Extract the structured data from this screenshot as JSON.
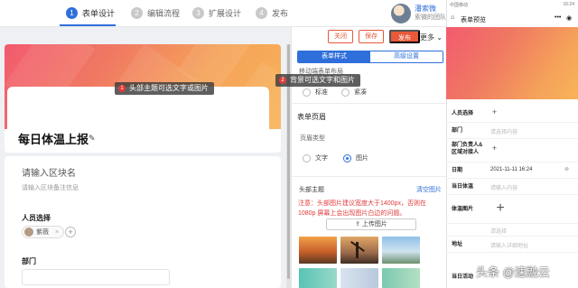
{
  "steps": [
    {
      "num": "1",
      "label": "表单设计"
    },
    {
      "num": "2",
      "label": "编辑流程"
    },
    {
      "num": "3",
      "label": "扩展设计"
    },
    {
      "num": "4",
      "label": "发布"
    }
  ],
  "user": {
    "name": "潘索微",
    "org": "索微的团队"
  },
  "toolbar": {
    "close": "关闭",
    "save": "保存",
    "publish": "发布",
    "more": "更多"
  },
  "form": {
    "title": "每日体温上报",
    "tip_header": "头部主题可选文字或图片",
    "tip_header_num": "1",
    "tip_bg": "背景可选文字和图片",
    "tip_bg_num": "2",
    "section_title_placeholder": "请输入区块名",
    "section_desc_placeholder": "请输入区块备注信息",
    "person_label": "人员选择",
    "person_chip": "紫薇",
    "chip_close": "×",
    "add": "+",
    "dept_label": "部门"
  },
  "panel": {
    "tab_form_style": "表单样式",
    "tab_advanced": "高级设置",
    "mobile_layout": "移动端表单布局",
    "layout_standard": "标准",
    "layout_compact": "紧凑",
    "header_section": "表单页眉",
    "header_type": "页眉类型",
    "type_text": "文字",
    "type_image": "图片",
    "header_theme": "头部主题",
    "clear_image": "清空图片",
    "warning": "注意：头部图片建议宽度大于1400px，否则在 1080p 屏幕上会出现图片白边的问题。",
    "upload": "上传图片"
  },
  "preview": {
    "status_left": "中国移动",
    "status_right": "16:24",
    "title": "表单预览",
    "rows": [
      {
        "label": "人员选择",
        "value": "+"
      },
      {
        "label": "部门",
        "value": "请选择内容"
      },
      {
        "label": "部门负责人&区域对接人",
        "value": "+"
      },
      {
        "label": "日期",
        "value": "2021-11-11 16:24"
      },
      {
        "label": "当日体温",
        "value": "请输入内容"
      },
      {
        "label": "体温图片",
        "value": "+"
      },
      {
        "label": "",
        "value": "请选择"
      },
      {
        "label": "地址",
        "value": "请输入详细地址"
      },
      {
        "label": "当日活动",
        "value": ""
      }
    ]
  },
  "watermark": "头条 @速融云",
  "colors": {
    "accent_blue": "#2f6fdb",
    "accent_orange": "#e8593a",
    "warning_red": "#e23b3b"
  }
}
